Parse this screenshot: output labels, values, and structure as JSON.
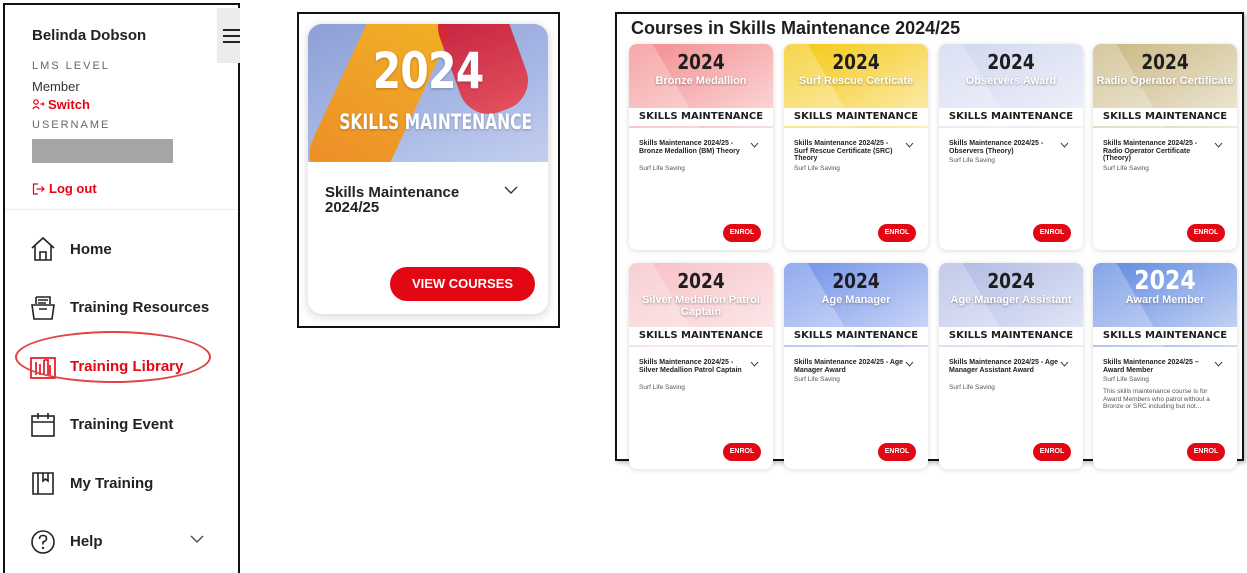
{
  "sidebar": {
    "user_name": "Belinda Dobson",
    "lms_level_caption": "LMS LEVEL",
    "lms_level_value": "Member",
    "switch_label": "Switch",
    "username_caption": "USERNAME",
    "logout_label": "Log out",
    "nav": [
      {
        "label": "Home",
        "icon": "home-icon"
      },
      {
        "label": "Training Resources",
        "icon": "resources-tray-icon"
      },
      {
        "label": "Training Library",
        "icon": "library-icon",
        "active": true
      },
      {
        "label": "Training Event",
        "icon": "calendar-icon"
      },
      {
        "label": "My Training",
        "icon": "book-bookmark-icon"
      },
      {
        "label": "Help",
        "icon": "help-circle-icon"
      }
    ]
  },
  "featured": {
    "image_year": "2024",
    "image_caption": "SKILLS MAINTENANCE",
    "title": "Skills Maintenance 2024/25",
    "button_label": "VIEW COURSES"
  },
  "courses": {
    "heading": "Courses in Skills Maintenance 2024/25",
    "banner": "SKILLS MAINTENANCE",
    "enrol_label": "ENROL",
    "items": [
      {
        "year": "2024",
        "name": "Bronze Medallion",
        "title": "Skills Maintenance 2024/25 - Bronze Medallion (BM) Theory",
        "org": "Surf Life Saving",
        "desc": "",
        "bg": "#f38a8c"
      },
      {
        "year": "2024",
        "name": "Surf Rescue Certicate",
        "title": "Skills Maintenance 2024/25 - Surf Rescue Certificate (SRC) Theory",
        "org": "Surf Life Saving",
        "desc": "",
        "bg": "#f4c70f"
      },
      {
        "year": "2024",
        "name": "Observers Award",
        "title": "Skills Maintenance 2024/25 - Observers (Theory)",
        "org": "Surf Life Saving",
        "desc": "",
        "bg": "#cfd6ef"
      },
      {
        "year": "2024",
        "name": "Radio Operator Certificate",
        "title": "Skills Maintenance 2024/25 - Radio Operator Certificate (Theory)",
        "org": "Surf Life Saving",
        "desc": "",
        "bg": "#c9b680"
      },
      {
        "year": "2024",
        "name": "Silver Medallion Patrol Captain",
        "title": "Skills Maintenance 2024/25 - Silver Medallion Patrol Captain",
        "org": "Surf Life Saving",
        "desc": "",
        "bg": "#f6bfc4"
      },
      {
        "year": "2024",
        "name": "Age Manager",
        "title": "Skills Maintenance 2024/25 - Age Manager Award",
        "org": "Surf Life Saving",
        "desc": "",
        "bg": "#6f8fe8"
      },
      {
        "year": "2024",
        "name": "Age Manager Assistant",
        "title": "Skills Maintenance 2024/25 - Age Manager Assistant Award",
        "org": "Surf Life Saving",
        "desc": "",
        "bg": "#aeb9e3"
      },
      {
        "year": "2024",
        "name": "Award Member",
        "title": "Skills Maintenance 2024/25 – Award Member",
        "org": "Surf Life Saving",
        "desc": "This skills maintenance course is for Award Members who patrol without a Bronze or SRC including but not...",
        "bg": "#5d86e0"
      }
    ]
  }
}
